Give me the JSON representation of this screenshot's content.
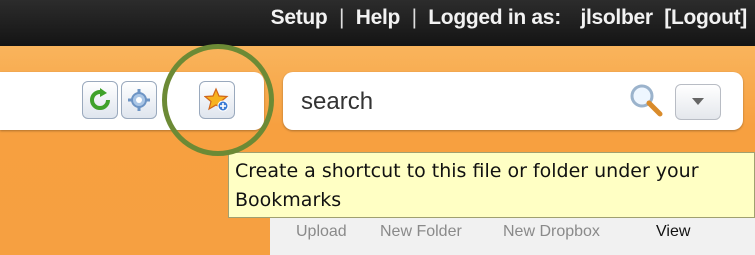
{
  "topnav": {
    "setup": "Setup",
    "sep1": "|",
    "help": "Help",
    "sep2": "|",
    "logged_in_label": "Logged in as:",
    "username": "jlsolber",
    "logout": "[Logout]"
  },
  "toolbar": {
    "icons": [
      "refresh-icon",
      "gear-icon",
      "bookmark-star-icon"
    ]
  },
  "search": {
    "value": "search",
    "search_icon": "magnifier-icon",
    "dropdown_icon": "chevron-down-icon"
  },
  "tooltip": {
    "text": "Create a shortcut to this file or folder under your Bookmarks"
  },
  "actions": {
    "upload": "Upload",
    "new_folder": "New Folder",
    "new_dropbox": "New Dropbox",
    "view": "View"
  },
  "colors": {
    "topbar": "#1c1c1c",
    "orange": "#f7a040",
    "tooltip_bg": "#ffffc4",
    "annotation_circle": "#6c8a35"
  }
}
